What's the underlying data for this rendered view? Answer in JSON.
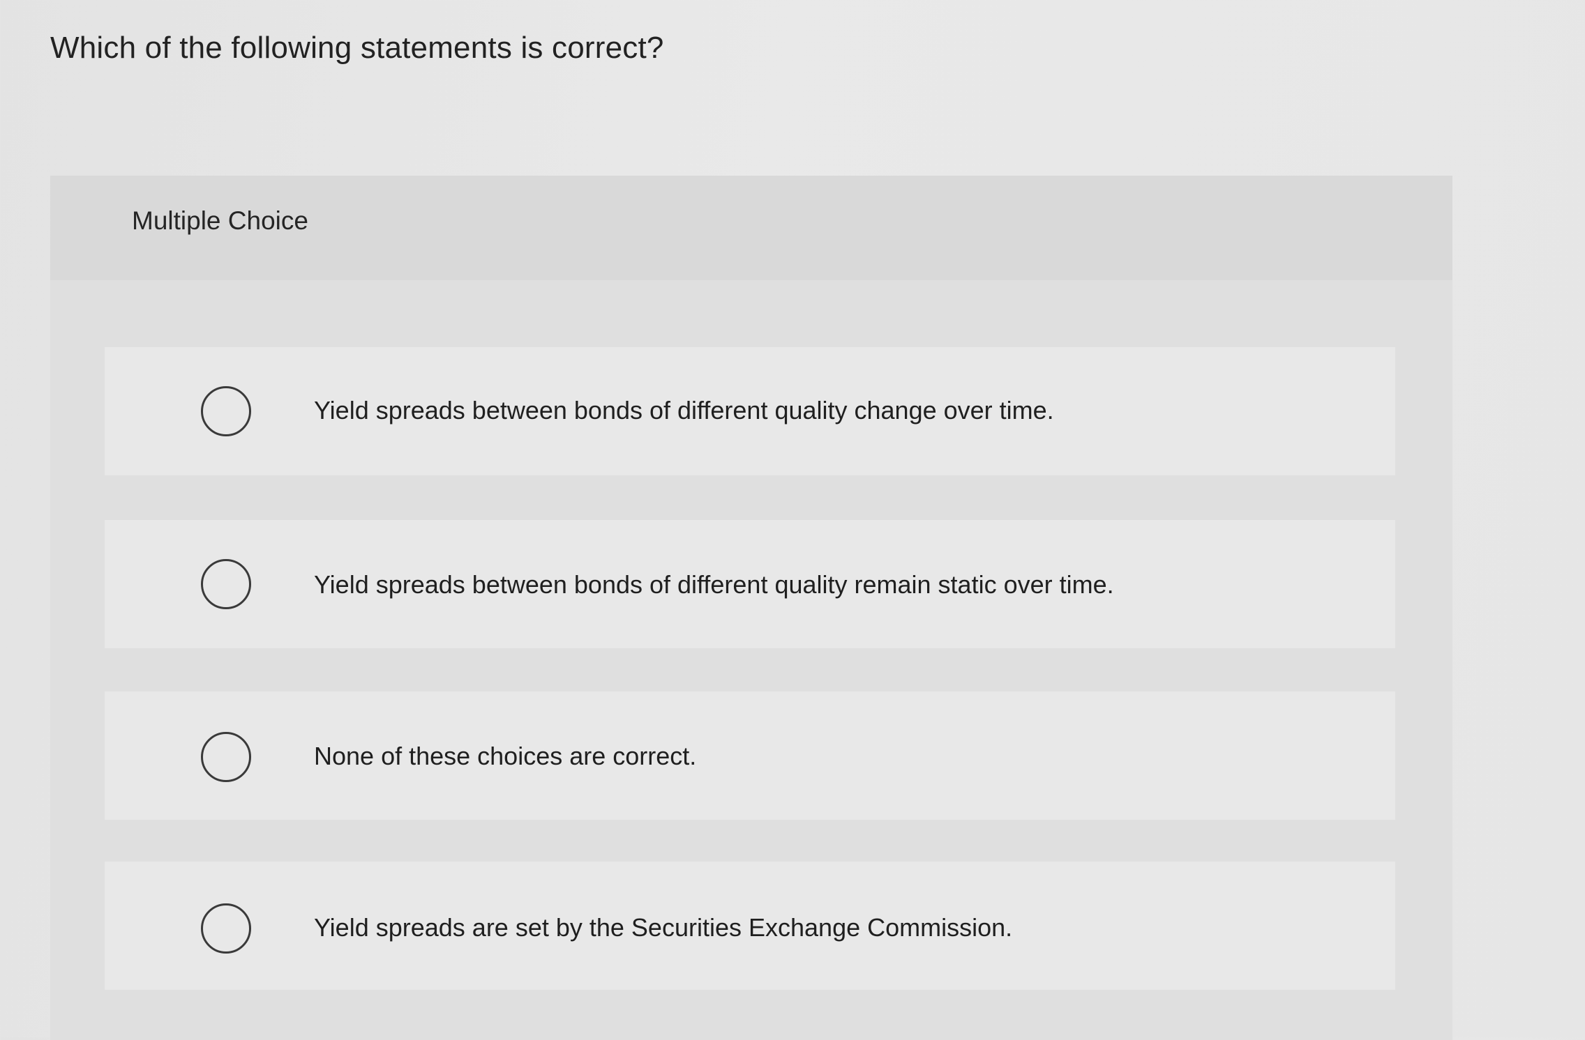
{
  "question": {
    "text": "Which of the following statements is correct?"
  },
  "panel": {
    "header_label": "Multiple Choice"
  },
  "choices": [
    {
      "label": "Yield spreads between bonds of different quality change over time.",
      "selected": false
    },
    {
      "label": "Yield spreads between bonds of different quality remain static over time.",
      "selected": false
    },
    {
      "label": "None of these choices are correct.",
      "selected": false
    },
    {
      "label": "Yield spreads are set by the Securities Exchange Commission.",
      "selected": false
    }
  ]
}
